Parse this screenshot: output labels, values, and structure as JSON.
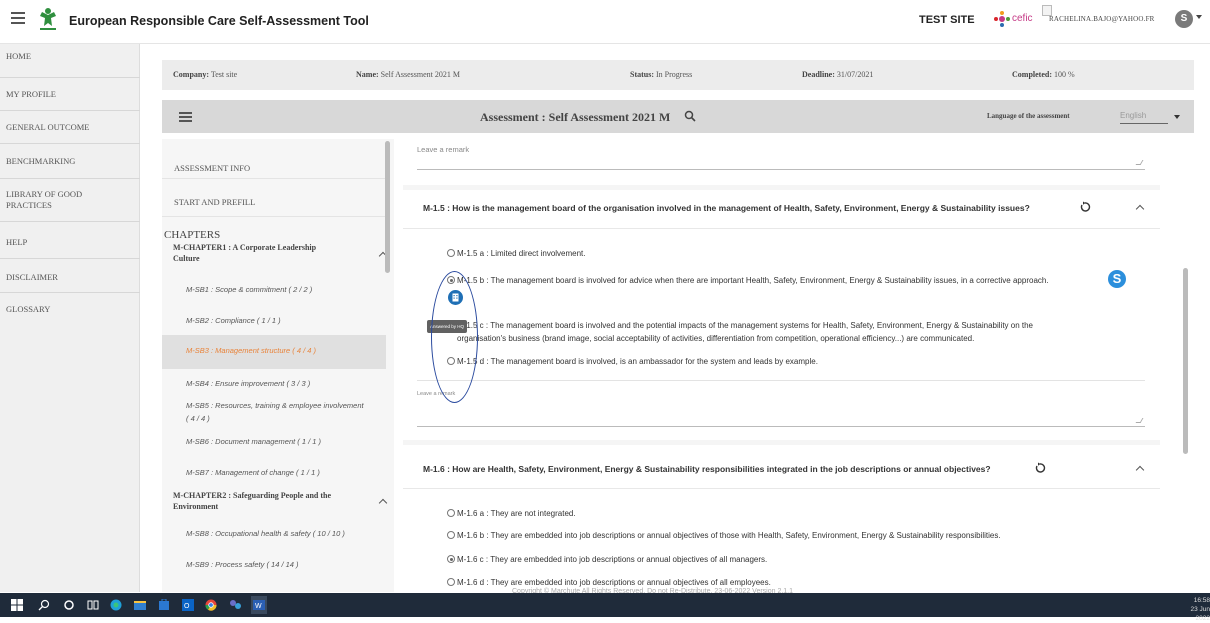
{
  "app": {
    "title": "European Responsible Care Self-Assessment Tool",
    "site_label": "TEST SITE",
    "partner_logo_text": "cefic",
    "user_email": "RACHELINA.BAJO@YAHOO.FR",
    "user_initial": "S"
  },
  "left_nav": [
    {
      "label": "HOME"
    },
    {
      "label": "MY PROFILE"
    },
    {
      "label": "GENERAL OUTCOME"
    },
    {
      "label": "BENCHMARKING"
    },
    {
      "label": "LIBRARY OF GOOD PRACTICES"
    },
    {
      "label": "HELP"
    },
    {
      "label": "DISCLAIMER"
    },
    {
      "label": "GLOSSARY"
    }
  ],
  "info_bar": {
    "company_label": "Company:",
    "company_value": "Test site",
    "name_label": "Name:",
    "name_value": "Self Assessment 2021 M",
    "status_label": "Status:",
    "status_value": "In Progress",
    "deadline_label": "Deadline:",
    "deadline_value": "31/07/2021",
    "completed_label": "Completed:",
    "completed_value": "100 %"
  },
  "assessment_header": {
    "title": "Assessment : Self Assessment 2021 M",
    "language_label": "Language of the assessment",
    "language_value": "English"
  },
  "chapters_panel": {
    "assessment_info": "ASSESSMENT INFO",
    "start_prefill": "START AND PREFILL",
    "chapters_heading": "CHAPTERS",
    "chapter1": "M-CHAPTER1 : A Corporate Leadership Culture",
    "chapter1_items": [
      "M-SB1 : Scope & commitment ( 2 / 2 )",
      "M-SB2 : Compliance ( 1 / 1 )",
      "M-SB3 : Management structure ( 4 / 4 )",
      "M-SB4 : Ensure improvement ( 3 / 3 )",
      "M-SB5 : Resources, training & employee involvement",
      "( 4 / 4 )",
      "M-SB6 : Document management ( 1 / 1 )",
      "M-SB7 : Management of change ( 1 / 1 )"
    ],
    "chapter2": "M-CHAPTER2 : Safeguarding People and the Environment",
    "chapter2_items": [
      "M-SB8 : Occupational health & safety ( 10 / 10 )",
      "M-SB9 : Process safety ( 14 / 14 )"
    ]
  },
  "main": {
    "remark_placeholder": "Leave a remark",
    "q15": {
      "title": "M-1.5 : How is the management board of the organisation involved in the management of Health, Safety, Environment, Energy & Sustainability issues?",
      "opt_a": "M-1.5 a : Limited direct involvement.",
      "opt_b": "M-1.5 b : The management board is involved for advice when there are important Health, Safety, Environment, Energy & Sustainability issues, in a corrective approach.",
      "opt_c_line1": "M-1.5 c : The management board is involved and the potential impacts of the management systems for Health, Safety, Environment, Energy & Sustainability on the",
      "opt_c_line2": "organisation's business (brand image, social acceptability of activities, differentiation from competition, operational efficiency...) are communicated.",
      "opt_d": "M-1.5 d : The management board is involved, is an ambassador for the system and leads by example.",
      "tooltip": "Answered by HQ"
    },
    "q16": {
      "title": "M-1.6 : How are Health, Safety, Environment, Energy & Sustainability responsibilities integrated in the job descriptions or annual objectives?",
      "opt_a": "M-1.6 a : They are not integrated.",
      "opt_b": "M-1.6 b : They are embedded into job descriptions or annual objectives of those with Health, Safety, Environment, Energy & Sustainability responsibilities.",
      "opt_c": "M-1.6 c : They are embedded into job descriptions or annual objectives of all managers.",
      "opt_d": "M-1.6 d : They are embedded into job descriptions or annual objectives of all employees."
    },
    "copyright": "Copyright © Marchute All Rights Reserved. Do not Re-Distribute. 23-06-2022 Version 2.1.1"
  },
  "taskbar": {
    "time": "16:58",
    "date": "23 Jun 2022"
  }
}
